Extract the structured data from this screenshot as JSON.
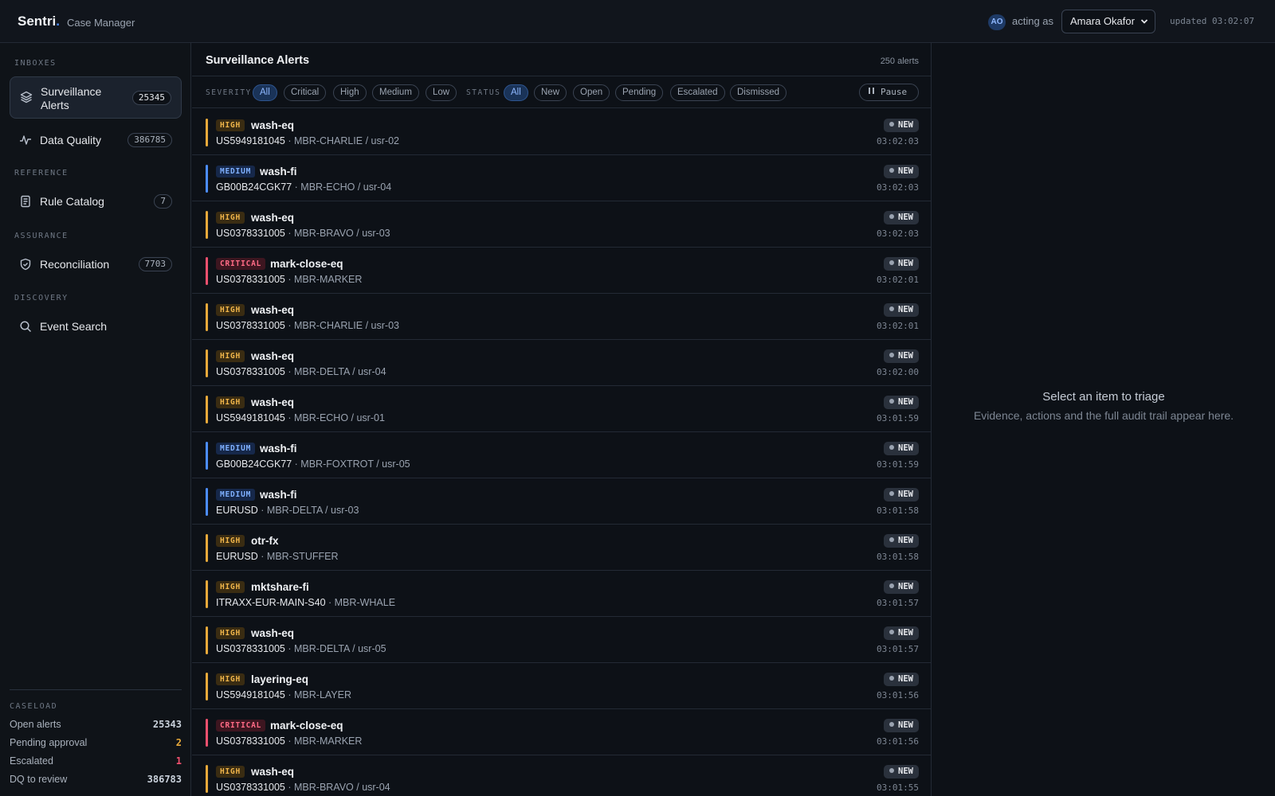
{
  "header": {
    "brand": "Sentri",
    "brand_dot": ".",
    "subtitle": "Case Manager",
    "avatar_initials": "AO",
    "acting_as": "acting as",
    "user": "Amara Okafor",
    "updated": "updated 03:02:07"
  },
  "sidebar": {
    "sections": {
      "inboxes": "INBOXES",
      "reference": "REFERENCE",
      "assurance": "ASSURANCE",
      "discovery": "DISCOVERY"
    },
    "items": [
      {
        "label_line1": "Surveillance",
        "label_line2": "Alerts",
        "count": "25345",
        "icon": "layers-icon"
      },
      {
        "label": "Data Quality",
        "count": "386785",
        "icon": "activity-icon"
      },
      {
        "label": "Rule Catalog",
        "count": "7",
        "icon": "document-icon"
      },
      {
        "label": "Reconciliation",
        "count": "7703",
        "icon": "shield-check-icon"
      },
      {
        "label": "Event Search",
        "icon": "search-icon"
      }
    ],
    "caseload": {
      "title": "CASELOAD",
      "stats": [
        {
          "label": "Open alerts",
          "value": "25343",
          "color": "#c9d1db"
        },
        {
          "label": "Pending approval",
          "value": "2",
          "color": "#e8a93a"
        },
        {
          "label": "Escalated",
          "value": "1",
          "color": "#f0506e"
        },
        {
          "label": "DQ to review",
          "value": "386783",
          "color": "#c9d1db"
        }
      ]
    }
  },
  "main": {
    "title": "Surveillance Alerts",
    "count": "250 alerts",
    "severity_label": "SEVERITY",
    "severity_filters": [
      "All",
      "Critical",
      "High",
      "Medium",
      "Low"
    ],
    "status_label": "STATUS",
    "status_filters": [
      "All",
      "New",
      "Open",
      "Pending",
      "Escalated",
      "Dismissed"
    ],
    "pause_label": "Pause",
    "alerts": [
      {
        "severity": "HIGH",
        "rule": "wash-eq",
        "instrument": "US5949181045",
        "member": " · MBR-CHARLIE / usr-02",
        "status": "NEW",
        "time": "03:02:03"
      },
      {
        "severity": "MEDIUM",
        "rule": "wash-fi",
        "instrument": "GB00B24CGK77",
        "member": " · MBR-ECHO / usr-04",
        "status": "NEW",
        "time": "03:02:03"
      },
      {
        "severity": "HIGH",
        "rule": "wash-eq",
        "instrument": "US0378331005",
        "member": " · MBR-BRAVO / usr-03",
        "status": "NEW",
        "time": "03:02:03"
      },
      {
        "severity": "CRITICAL",
        "rule": "mark-close-eq",
        "instrument": "US0378331005",
        "member": " · MBR-MARKER",
        "status": "NEW",
        "time": "03:02:01"
      },
      {
        "severity": "HIGH",
        "rule": "wash-eq",
        "instrument": "US0378331005",
        "member": " · MBR-CHARLIE / usr-03",
        "status": "NEW",
        "time": "03:02:01"
      },
      {
        "severity": "HIGH",
        "rule": "wash-eq",
        "instrument": "US0378331005",
        "member": " · MBR-DELTA / usr-04",
        "status": "NEW",
        "time": "03:02:00"
      },
      {
        "severity": "HIGH",
        "rule": "wash-eq",
        "instrument": "US5949181045",
        "member": " · MBR-ECHO / usr-01",
        "status": "NEW",
        "time": "03:01:59"
      },
      {
        "severity": "MEDIUM",
        "rule": "wash-fi",
        "instrument": "GB00B24CGK77",
        "member": " · MBR-FOXTROT / usr-05",
        "status": "NEW",
        "time": "03:01:59"
      },
      {
        "severity": "MEDIUM",
        "rule": "wash-fi",
        "instrument": "EURUSD",
        "member": " · MBR-DELTA / usr-03",
        "status": "NEW",
        "time": "03:01:58"
      },
      {
        "severity": "HIGH",
        "rule": "otr-fx",
        "instrument": "EURUSD",
        "member": " · MBR-STUFFER",
        "status": "NEW",
        "time": "03:01:58"
      },
      {
        "severity": "HIGH",
        "rule": "mktshare-fi",
        "instrument": "ITRAXX-EUR-MAIN-S40",
        "member": " · MBR-WHALE",
        "status": "NEW",
        "time": "03:01:57"
      },
      {
        "severity": "HIGH",
        "rule": "wash-eq",
        "instrument": "US0378331005",
        "member": " · MBR-DELTA / usr-05",
        "status": "NEW",
        "time": "03:01:57"
      },
      {
        "severity": "HIGH",
        "rule": "layering-eq",
        "instrument": "US5949181045",
        "member": " · MBR-LAYER",
        "status": "NEW",
        "time": "03:01:56"
      },
      {
        "severity": "CRITICAL",
        "rule": "mark-close-eq",
        "instrument": "US0378331005",
        "member": " · MBR-MARKER",
        "status": "NEW",
        "time": "03:01:56"
      },
      {
        "severity": "HIGH",
        "rule": "wash-eq",
        "instrument": "US0378331005",
        "member": " · MBR-BRAVO / usr-04",
        "status": "NEW",
        "time": "03:01:55"
      }
    ]
  },
  "severity_colors": {
    "HIGH": {
      "bar": "#e8a93a",
      "bg": "#3a2c12",
      "fg": "#f0b54a"
    },
    "MEDIUM": {
      "bar": "#4c8dff",
      "bg": "#16284a",
      "fg": "#7fb0ff"
    },
    "CRITICAL": {
      "bar": "#f0506e",
      "bg": "#3d1620",
      "fg": "#ff6b86"
    }
  },
  "detail": {
    "empty_title": "Select an item to triage",
    "empty_text": "Evidence, actions and the full audit trail appear here."
  }
}
